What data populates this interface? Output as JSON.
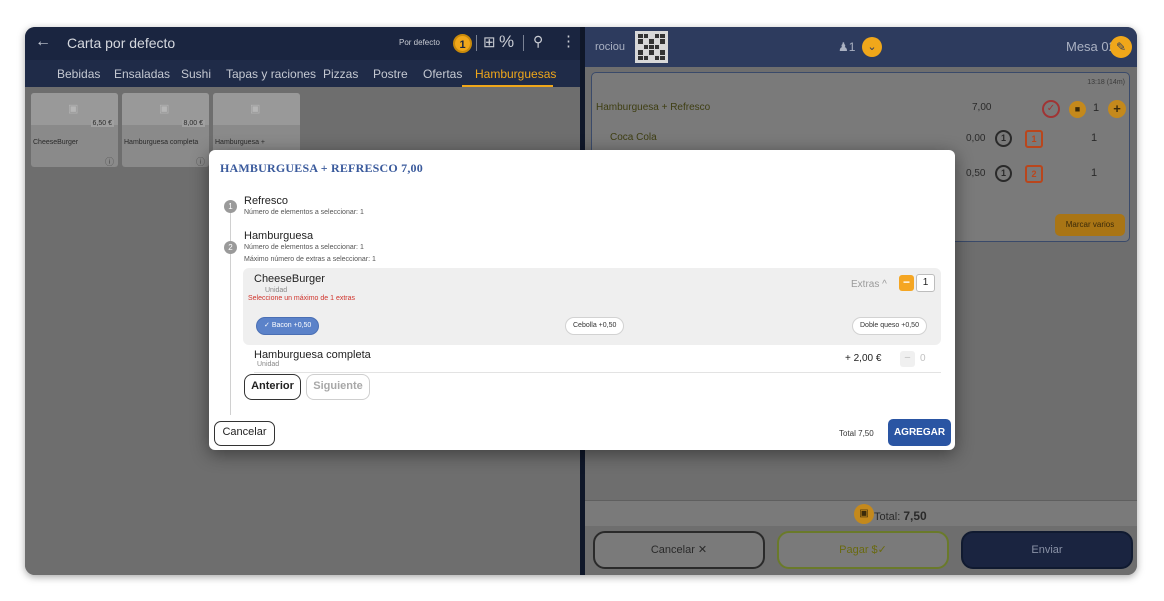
{
  "left_header": {
    "back_icon": "arrow-left-icon",
    "title": "Carta por defecto",
    "tariff_label": "Por defecto",
    "tariff_badge": "1",
    "calc_icon": "calculator-icon",
    "percent_icon": "%",
    "search_icon": "search-icon",
    "more_icon": "more-vertical-icon"
  },
  "categories": [
    {
      "label": "Bebidas"
    },
    {
      "label": "Ensaladas"
    },
    {
      "label": "Sushi"
    },
    {
      "label": "Tapas y raciones"
    },
    {
      "label": "Pizzas"
    },
    {
      "label": "Postre"
    },
    {
      "label": "Ofertas"
    },
    {
      "label": "Hamburguesas",
      "active": true
    }
  ],
  "products": [
    {
      "name": "CheeseBurger",
      "price": "6,50 €"
    },
    {
      "name": "Hamburguesa completa",
      "price": "8,00 €"
    },
    {
      "name": "Hamburguesa +",
      "price": ""
    }
  ],
  "right_header": {
    "user": "rociou",
    "persons": "1",
    "table": "Mesa 02"
  },
  "order": {
    "time": "13:18 (14m)",
    "lines": [
      {
        "name": "Hamburguesa + Refresco",
        "amount": "7,00",
        "qty": "1"
      },
      {
        "name": "Coca Cola",
        "amount": "0,00",
        "order": "1",
        "course": "1",
        "qty": "1"
      },
      {
        "name": "",
        "amount": "0,50",
        "order": "1",
        "course": "2",
        "qty": "1"
      }
    ],
    "marcar_label": "Marcar varios"
  },
  "footer": {
    "total_label": "Total: ",
    "total_value": "7,50",
    "cancel_label": "Cancelar ✕",
    "pay_label": "Pagar",
    "send_label": "Enviar"
  },
  "modal": {
    "title": "HAMBURGUESA + REFRESCO  7,00",
    "steps": [
      {
        "num": "1",
        "name": "Refresco",
        "note1": "Número de elementos a seleccionar: 1",
        "note2": ""
      },
      {
        "num": "2",
        "name": "Hamburguesa",
        "note1": "Número de elementos a seleccionar: 1",
        "note2": "Máximo número de extras a seleccionar: 1"
      }
    ],
    "option1": {
      "name": "CheeseBurger",
      "unit": "Unidad",
      "warning": "Seleccione un máximo de 1 extras",
      "extras_label": "Extras ^",
      "qty": "1",
      "chips": [
        {
          "label": "Bacon  +0,50",
          "selected": true
        },
        {
          "label": "Cebolla  +0,50",
          "selected": false
        },
        {
          "label": "Doble queso  +0,50",
          "selected": false
        }
      ]
    },
    "option2": {
      "name": "Hamburguesa completa",
      "unit": "Unidad",
      "price": "+ 2,00 €",
      "qty": "0"
    },
    "prev_label": "Anterior",
    "next_label": "Siguiente",
    "cancel_label": "Cancelar",
    "total_label": "Total 7,50",
    "add_label": "AGREGAR"
  }
}
